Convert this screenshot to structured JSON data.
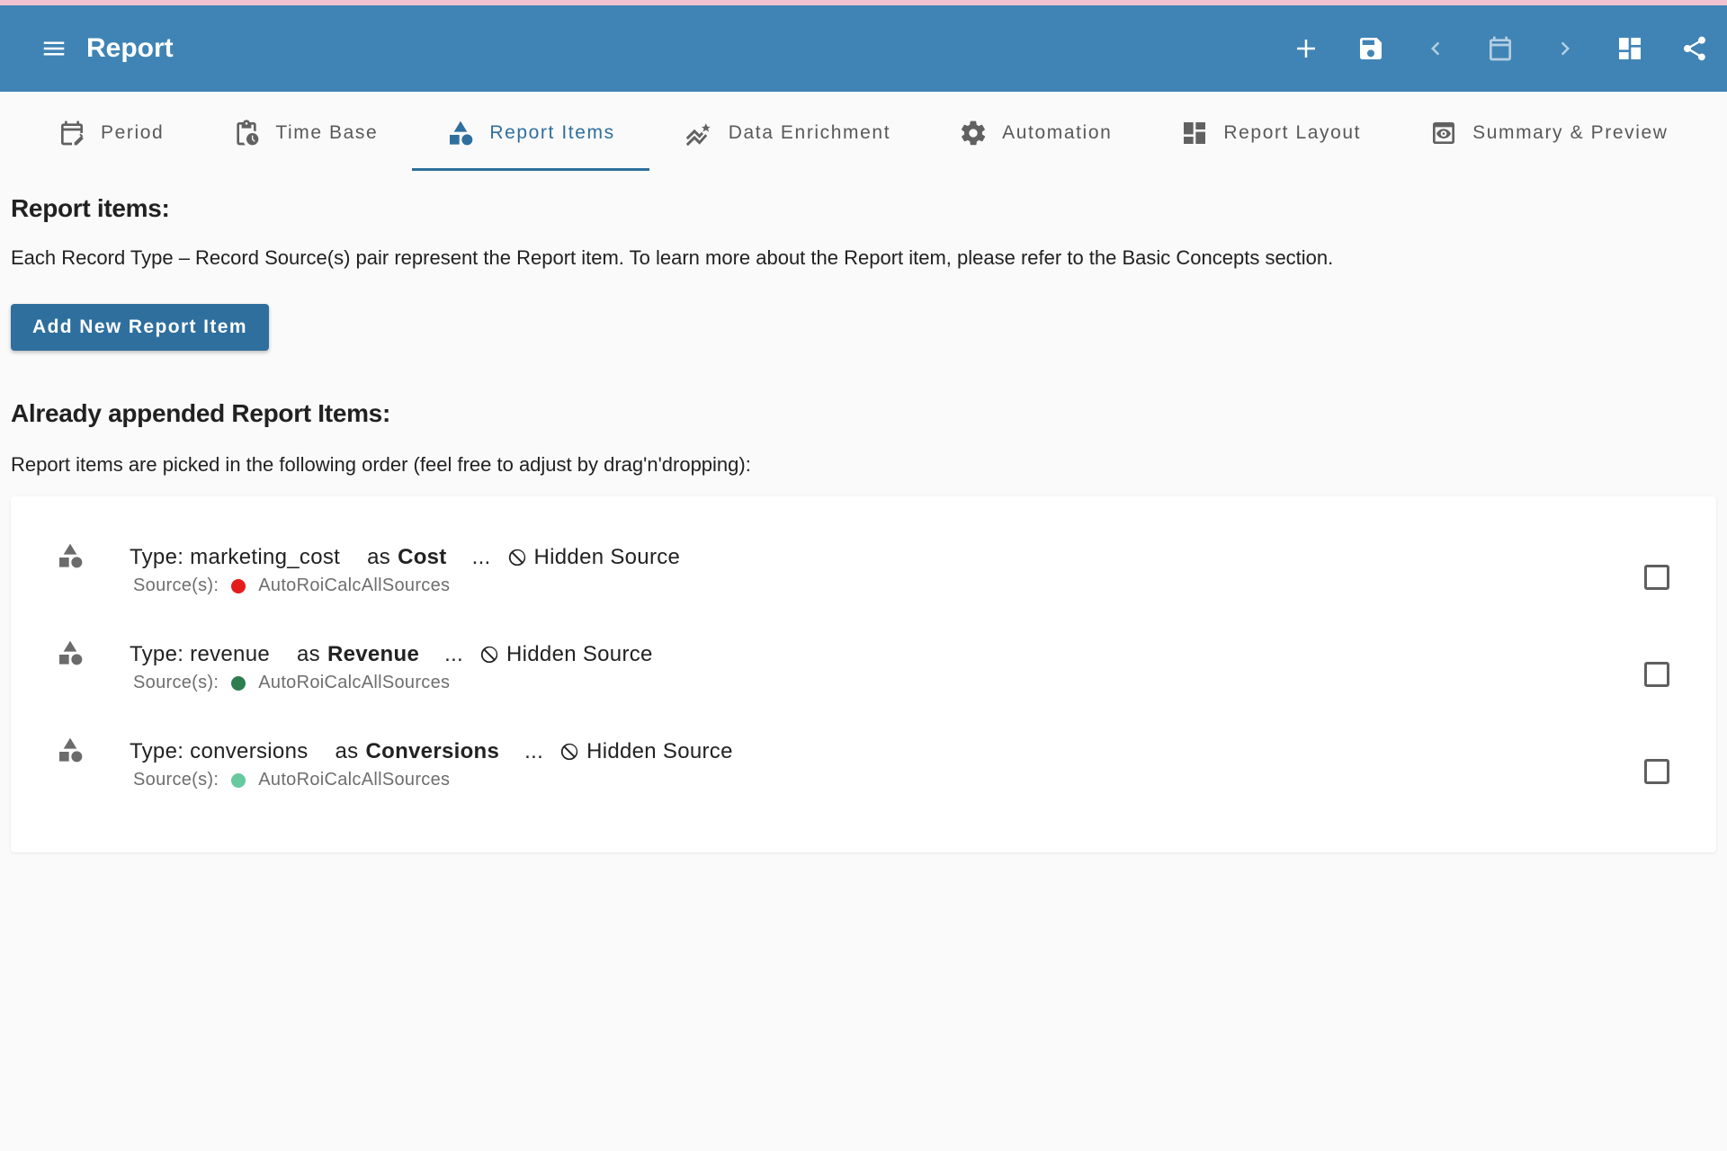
{
  "header": {
    "title": "Report",
    "menu_icon": "menu-icon",
    "actions": [
      "add-icon",
      "save-icon",
      "prev-icon",
      "calendar-icon",
      "next-icon",
      "dashboard-icon",
      "share-icon"
    ]
  },
  "tabs": [
    {
      "label": "Period",
      "icon": "edit-calendar-icon",
      "active": false
    },
    {
      "label": "Time Base",
      "icon": "clipboard-clock-icon",
      "active": false
    },
    {
      "label": "Report Items",
      "icon": "category-shapes-icon",
      "active": true
    },
    {
      "label": "Data Enrichment",
      "icon": "trend-sparkle-icon",
      "active": false
    },
    {
      "label": "Automation",
      "icon": "gear-icon",
      "active": false
    },
    {
      "label": "Report Layout",
      "icon": "dashboard-icon",
      "active": false
    },
    {
      "label": "Summary & Preview",
      "icon": "preview-eye-icon",
      "active": false
    }
  ],
  "report_items_section": {
    "heading": "Report items:",
    "description": "Each Record Type – Record Source(s) pair represent the Report item. To learn more about the Report item, please refer to the Basic Concepts section.",
    "add_button": "Add New Report Item"
  },
  "appended_section": {
    "heading": "Already appended Report Items:",
    "description": "Report items are picked in the following order (feel free to adjust by drag'n'dropping):"
  },
  "items": [
    {
      "type_text": "Type: marketing_cost",
      "as_text": "as",
      "alias": "Cost",
      "dots": "...",
      "hidden_label": "Hidden Source",
      "sources_label": "Source(s):",
      "source": "AutoRoiCalcAllSources",
      "dot_color": "#e51c1c",
      "checked": false
    },
    {
      "type_text": "Type: revenue",
      "as_text": "as",
      "alias": "Revenue",
      "dots": "...",
      "hidden_label": "Hidden Source",
      "sources_label": "Source(s):",
      "source": "AutoRoiCalcAllSources",
      "dot_color": "#2e7d4f",
      "checked": false
    },
    {
      "type_text": "Type: conversions",
      "as_text": "as",
      "alias": "Conversions",
      "dots": "...",
      "hidden_label": "Hidden Source",
      "sources_label": "Source(s):",
      "source": "AutoRoiCalcAllSources",
      "dot_color": "#66c9a0",
      "checked": false
    }
  ],
  "colors": {
    "topbar": "#4084b5",
    "accent_strip": "#f0c2cf",
    "primary": "#2f6f9e"
  }
}
